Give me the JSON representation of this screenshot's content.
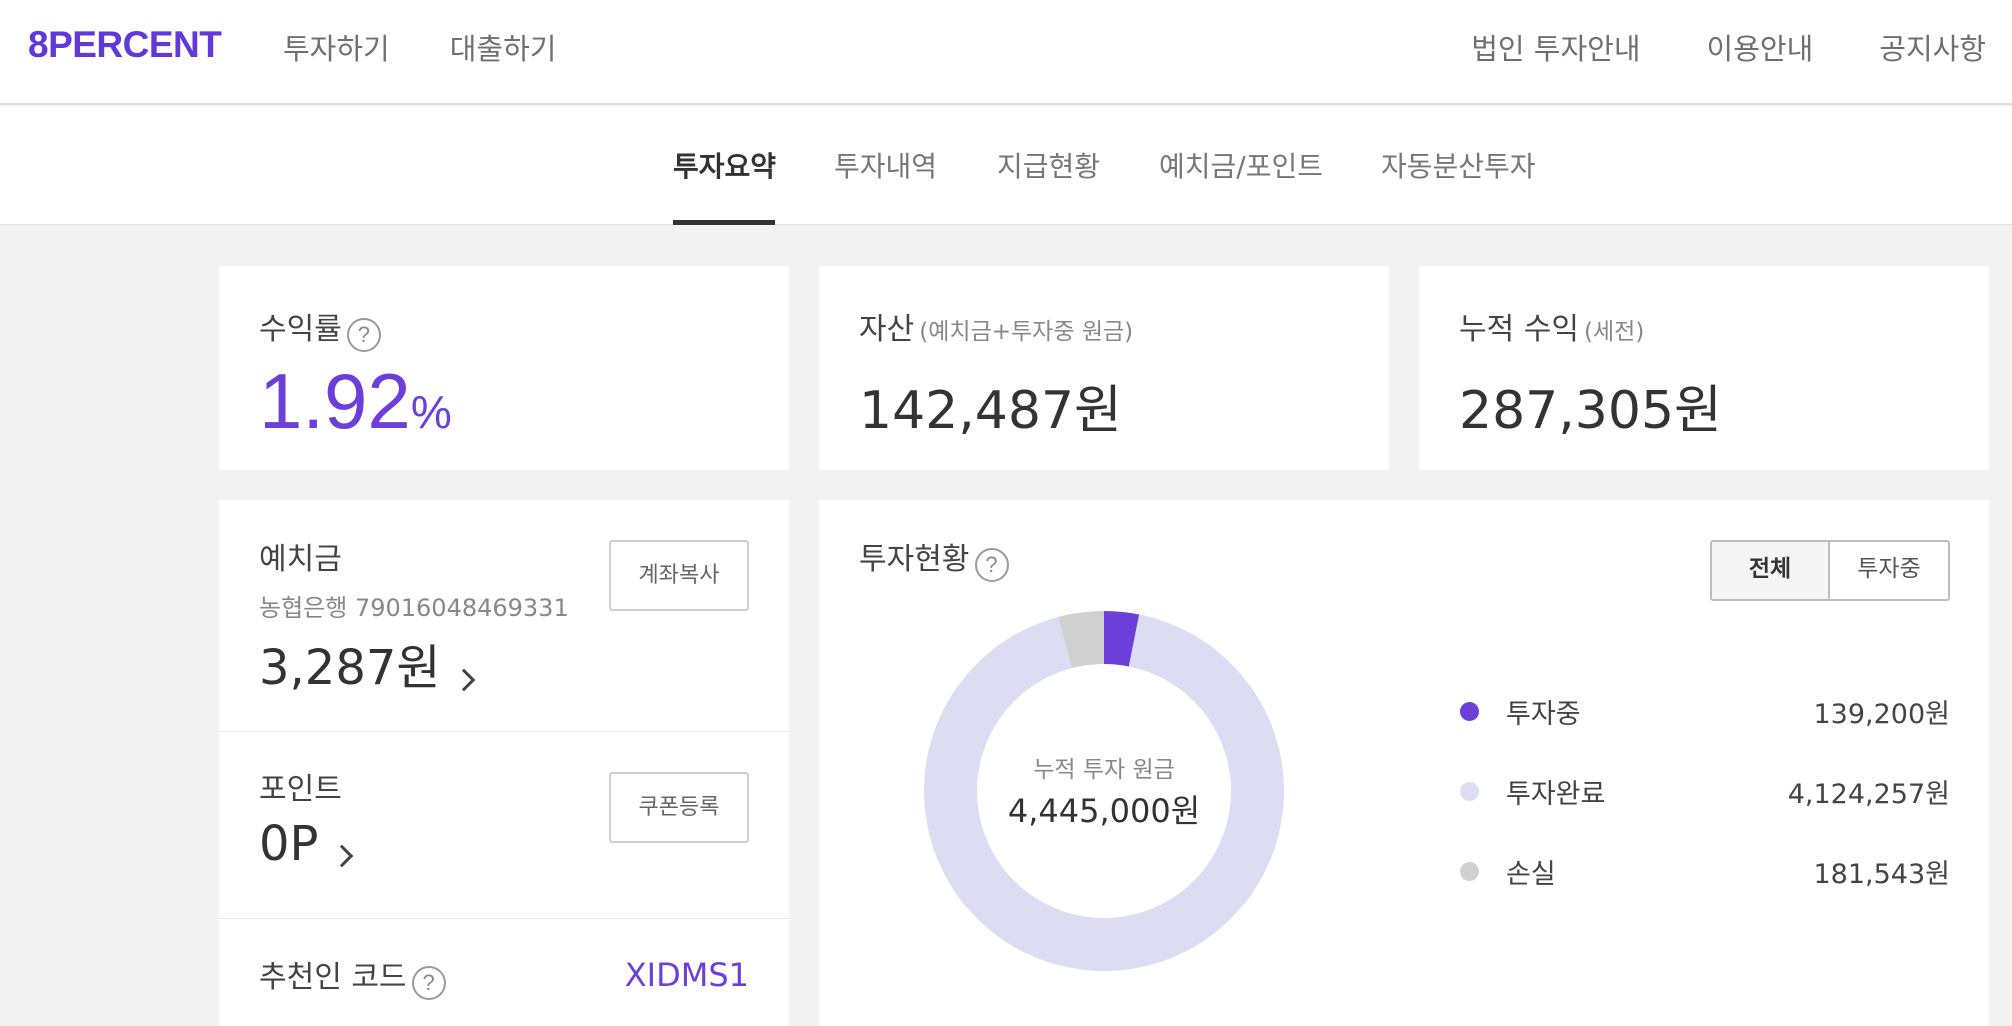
{
  "brand": {
    "logo_text": "8PERCENT",
    "accent": "#6c3fdb"
  },
  "top_nav": {
    "left": [
      "투자하기",
      "대출하기"
    ],
    "right": [
      "법인 투자안내",
      "이용안내",
      "공지사항"
    ]
  },
  "tabs": {
    "items": [
      "투자요약",
      "투자내역",
      "지급현황",
      "예치금/포인트",
      "자동분산투자"
    ],
    "active": "투자요약"
  },
  "summary": {
    "yield": {
      "label": "수익률",
      "value": "1.92",
      "unit": "%"
    },
    "assets": {
      "label": "자산",
      "sub": "(예치금+투자중 원금)",
      "value": "142,487원"
    },
    "cumulative": {
      "label": "누적 수익",
      "sub": "(세전)",
      "value": "287,305원"
    }
  },
  "deposit": {
    "label": "예치금",
    "account": "농협은행 79016048469331",
    "value": "3,287원",
    "button": "계좌복사"
  },
  "points": {
    "label": "포인트",
    "value": "0P",
    "button": "쿠폰등록"
  },
  "referral": {
    "label": "추천인 코드",
    "code": "XIDMS1"
  },
  "investment": {
    "label": "투자현황",
    "filters": [
      "전체",
      "투자중"
    ],
    "active_filter": "전체",
    "donut_center_label": "누적 투자 원금",
    "donut_center_value": "4,445,000원",
    "legend": [
      {
        "name": "투자중",
        "value": "139,200원",
        "color": "#6c3fdb"
      },
      {
        "name": "투자완료",
        "value": "4,124,257원",
        "color": "#dcdcf2"
      },
      {
        "name": "손실",
        "value": "181,543원",
        "color": "#d0d0d0"
      }
    ]
  },
  "chart_data": {
    "type": "pie",
    "categories": [
      "투자중",
      "투자완료",
      "손실"
    ],
    "values": [
      139200,
      4124257,
      181543
    ],
    "colors": [
      "#6c3fdb",
      "#dcdcf2",
      "#d0d0d0"
    ]
  }
}
